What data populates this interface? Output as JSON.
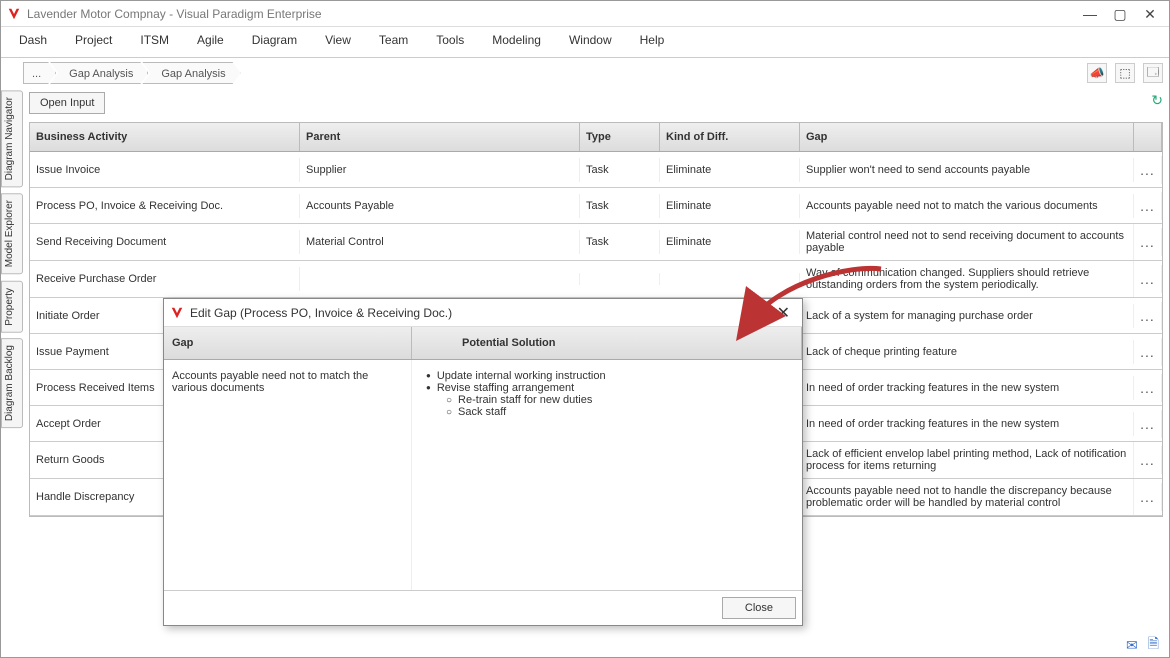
{
  "window": {
    "title": "Lavender Motor Compnay - Visual Paradigm Enterprise"
  },
  "menubar": [
    "Dash",
    "Project",
    "ITSM",
    "Agile",
    "Diagram",
    "View",
    "Team",
    "Tools",
    "Modeling",
    "Window",
    "Help"
  ],
  "breadcrumbs": [
    "...",
    "Gap Analysis",
    "Gap Analysis"
  ],
  "open_input_label": "Open Input",
  "side_tabs": [
    "Diagram Navigator",
    "Model Explorer",
    "Property",
    "Diagram Backlog"
  ],
  "table": {
    "headers": {
      "activity": "Business Activity",
      "parent": "Parent",
      "type": "Type",
      "kind": "Kind of Diff.",
      "gap": "Gap"
    },
    "rows": [
      {
        "activity": "Issue Invoice",
        "parent": "Supplier",
        "type": "Task",
        "kind": "Eliminate",
        "gap": "Supplier won't need to send accounts payable"
      },
      {
        "activity": "Process PO, Invoice & Receiving Doc.",
        "parent": "Accounts Payable",
        "type": "Task",
        "kind": "Eliminate",
        "gap": "Accounts payable need not to match the various documents"
      },
      {
        "activity": "Send Receiving Document",
        "parent": "Material Control",
        "type": "Task",
        "kind": "Eliminate",
        "gap": "Material control need not to send receiving document to accounts payable"
      },
      {
        "activity": "Receive Purchase Order",
        "parent": "",
        "type": "",
        "kind": "",
        "gap": "Way of communication changed. Suppliers should retrieve outstanding orders from the system periodically."
      },
      {
        "activity": "Initiate Order",
        "parent": "",
        "type": "",
        "kind": "",
        "gap": "Lack of a system for managing purchase order"
      },
      {
        "activity": "Issue Payment",
        "parent": "",
        "type": "",
        "kind": "",
        "gap": "Lack of cheque printing feature"
      },
      {
        "activity": "Process Received Items",
        "parent": "",
        "type": "",
        "kind": "",
        "gap": "In need of order tracking features in the new system"
      },
      {
        "activity": "Accept Order",
        "parent": "",
        "type": "",
        "kind": "",
        "gap": "In need of order tracking features in the new system"
      },
      {
        "activity": "Return Goods",
        "parent": "",
        "type": "",
        "kind": "",
        "gap": "Lack of efficient envelop label printing method, Lack of notification process for items returning"
      },
      {
        "activity": "Handle Discrepancy",
        "parent": "",
        "type": "",
        "kind": "",
        "gap": "Accounts payable need not to handle the discrepancy because problematic order will be handled by material control"
      }
    ],
    "more_label": "..."
  },
  "dialog": {
    "title": "Edit Gap (Process PO, Invoice & Receiving Doc.)",
    "headers": {
      "gap": "Gap",
      "solution": "Potential Solution"
    },
    "gap_text": "Accounts payable need not to match the various documents",
    "solutions_l1": [
      "Update internal working instruction",
      "Revise staffing arrangement"
    ],
    "solutions_l2": [
      "Re-train staff for new duties",
      "Sack staff"
    ],
    "close_label": "Close"
  }
}
